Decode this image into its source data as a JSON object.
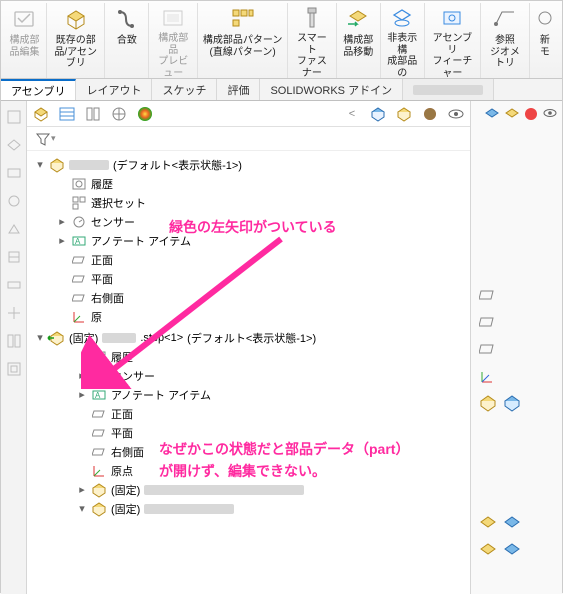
{
  "ribbon": {
    "edit_component": "構成部\n品編集",
    "existing_part": "既存の部\n品/アセンブリ",
    "mate": "合致",
    "preview": "構成部品\nプレビュー\nウィンドウ",
    "pattern": "構成部品パターン\n(直線パターン)",
    "smart_fastener": "スマート\nファスナー\n挿入",
    "move": "構成部\n品移動",
    "hidden": "非表示構\n成部品の\n表示",
    "assy_feature": "アセンブリ\nフィーチャー",
    "ref_geom": "参照\nジオメトリ",
    "new_motion": "新\nモ"
  },
  "tabs": [
    "アセンブリ",
    "レイアウト",
    "スケッチ",
    "評価",
    "SOLIDWORKS アドイン"
  ],
  "tree": {
    "root_suffix": " (デフォルト<表示状態-1>)",
    "history": "履歴",
    "selection_set": "選択セット",
    "sensor": "センサー",
    "annotation_item": "アノテート アイテム",
    "front": "正面",
    "top": "平面",
    "right": "右側面",
    "origin": "原点",
    "step_prefix": "(固定) ",
    "step_mid": ".step<1> ",
    "step_suffix": "(デフォルト<表示状態-1>)",
    "fixed_prefix": "(固定) "
  },
  "annotations": {
    "arrow_label": "緑色の左矢印がついている",
    "note_line1": "なぜかこの状態だと部品データ（part）",
    "note_line2": "が開けず、編集できない。"
  }
}
